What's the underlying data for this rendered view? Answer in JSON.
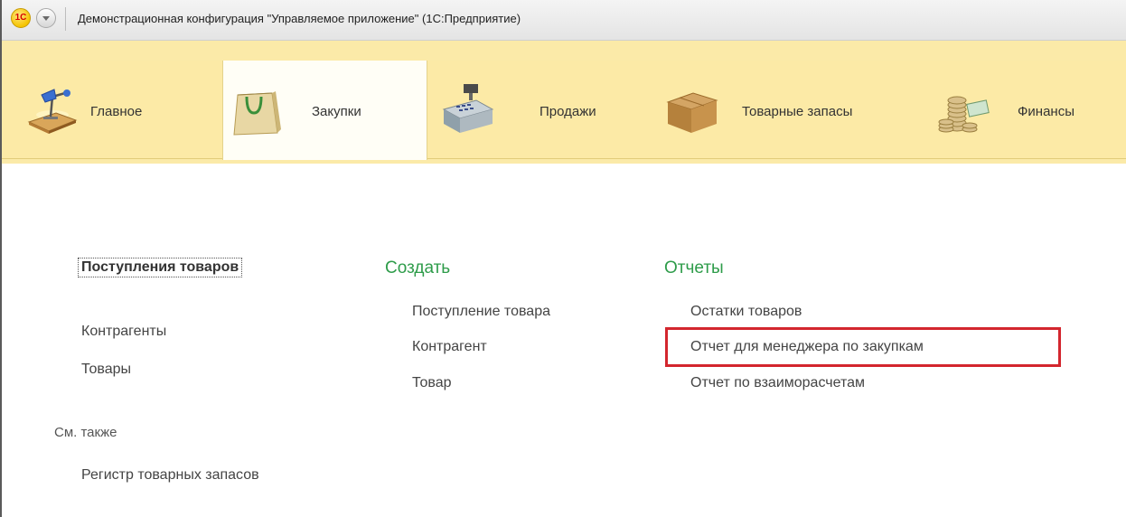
{
  "window": {
    "title": "Демонстрационная конфигурация \"Управляемое приложение\"  (1С:Предприятие)",
    "logo_text": "1C"
  },
  "sections": [
    {
      "label": "Главное",
      "icon": "desk-lamp-icon",
      "active": false
    },
    {
      "label": "Закупки",
      "icon": "shopping-bag-icon",
      "active": true
    },
    {
      "label": "Продажи",
      "icon": "cash-register-icon",
      "active": false
    },
    {
      "label": "Товарные запасы",
      "icon": "cardboard-box-icon",
      "active": false
    },
    {
      "label": "Финансы",
      "icon": "coins-money-icon",
      "active": false
    }
  ],
  "navigation": {
    "main_link": "Поступления товаров",
    "items": [
      "Контрагенты",
      "Товары"
    ],
    "see_also_title": "См. также",
    "see_also_items": [
      "Регистр товарных запасов"
    ]
  },
  "create": {
    "title": "Создать",
    "items": [
      "Поступление товара",
      "Контрагент",
      "Товар"
    ]
  },
  "reports": {
    "title": "Отчеты",
    "items": [
      "Остатки товаров",
      "Отчет для менеджера по закупкам",
      "Отчет по взаиморасчетам"
    ],
    "highlighted_item": "Отчет для менеджера по закупкам"
  },
  "colors": {
    "sections_bar": "#fceaa6",
    "group_title": "#2e9c4a",
    "highlight": "#d3262e"
  }
}
